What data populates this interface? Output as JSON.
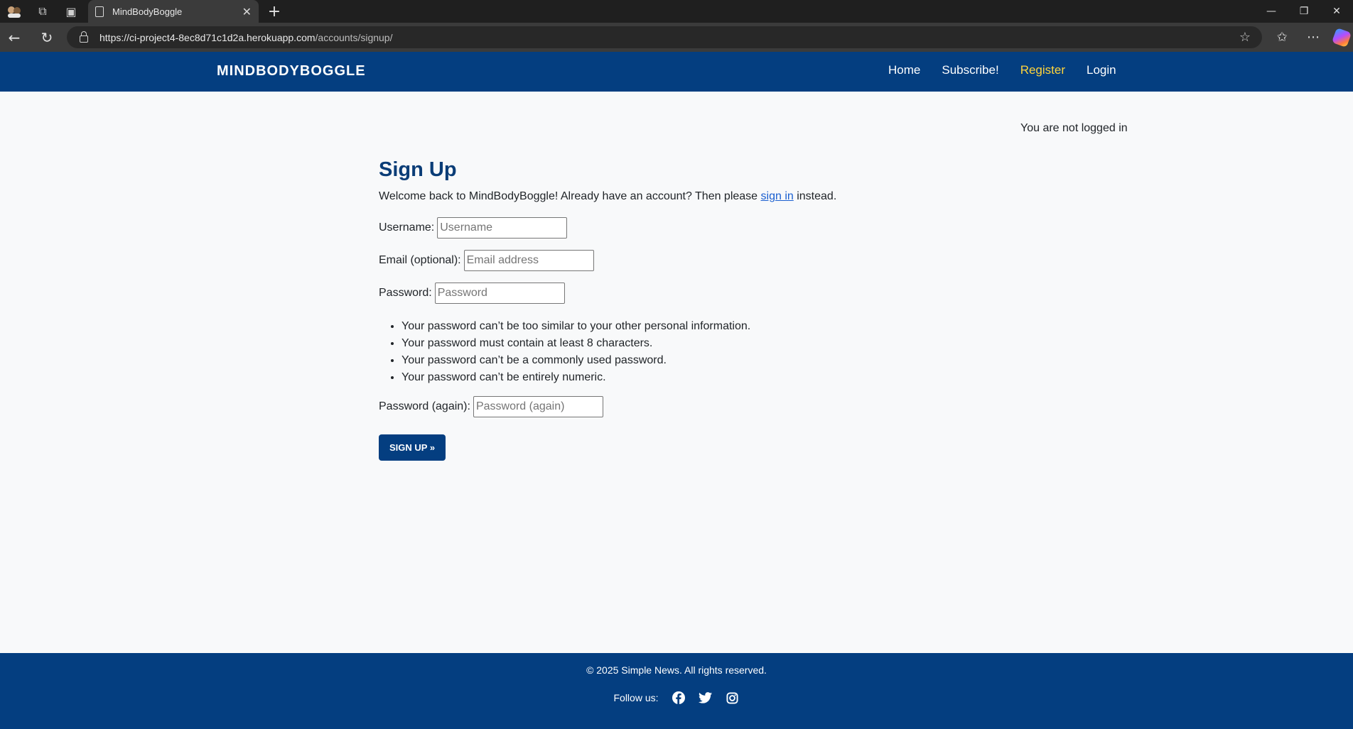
{
  "browser": {
    "tab_title": "MindBodyBoggle",
    "url_host": "https://ci-project4-8ec8d71c1d2a.herokuapp.com",
    "url_path": "/accounts/signup/"
  },
  "navbar": {
    "brand": "MINDBODYBOGGLE",
    "links": [
      {
        "label": "Home"
      },
      {
        "label": "Subscribe!"
      },
      {
        "label": "Register"
      },
      {
        "label": "Login"
      }
    ],
    "active_color": "#ffd43b",
    "bg_color": "#043e80"
  },
  "status": "You are not logged in",
  "form": {
    "title": "Sign Up",
    "intro_before": "Welcome back to MindBodyBoggle! Already have an account? Then please ",
    "intro_link": "sign in",
    "intro_after": " instead.",
    "username_label": "Username:",
    "username_placeholder": "Username",
    "email_label": "Email (optional):",
    "email_placeholder": "Email address",
    "password_label": "Password:",
    "password_placeholder": "Password",
    "password_help": [
      "Your password can’t be too similar to your other personal information.",
      "Your password must contain at least 8 characters.",
      "Your password can’t be a commonly used password.",
      "Your password can’t be entirely numeric."
    ],
    "password2_label": "Password (again):",
    "password2_placeholder": "Password (again)",
    "submit_label": "SIGN UP »"
  },
  "footer": {
    "copyright": "© 2025 Simple News. All rights reserved.",
    "follow_label": "Follow us:",
    "social_icons": [
      "facebook-icon",
      "twitter-icon",
      "instagram-icon"
    ]
  }
}
